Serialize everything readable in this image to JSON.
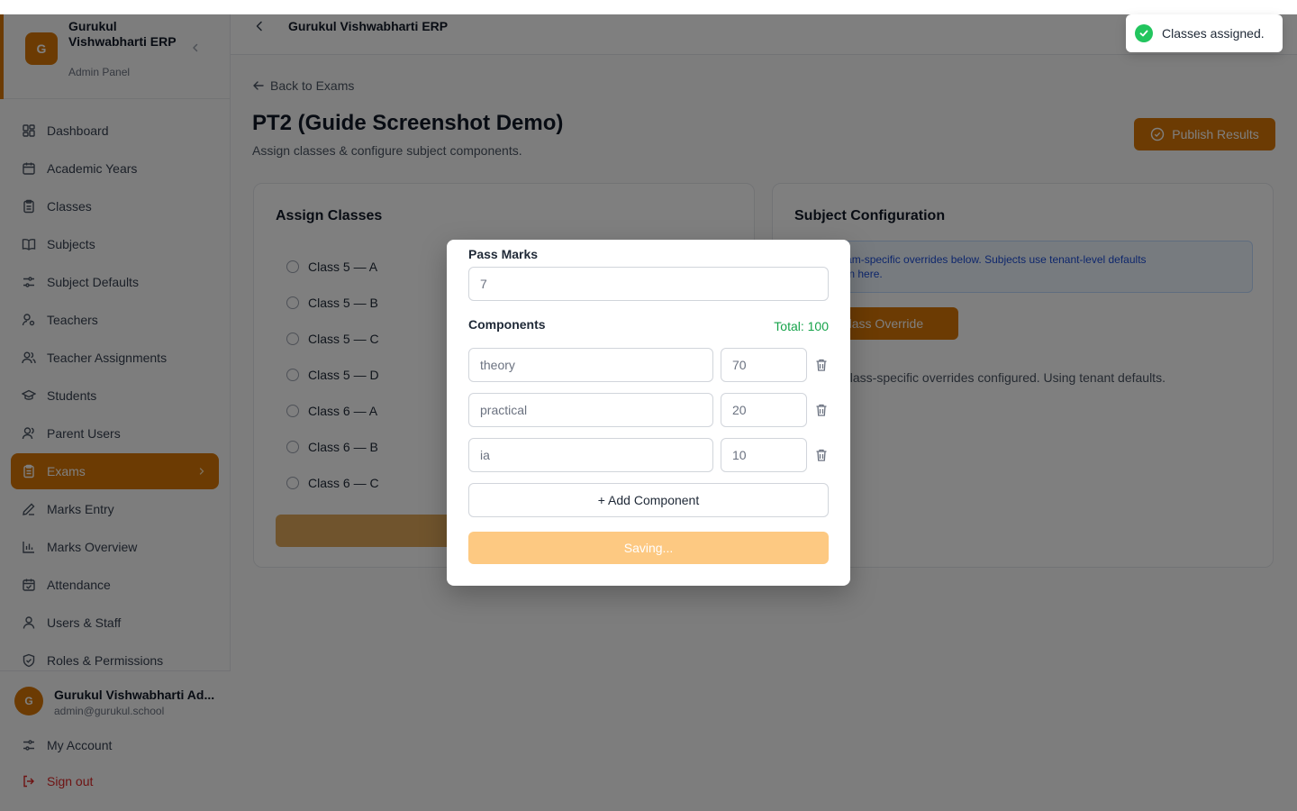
{
  "brand": {
    "logo_letter": "G",
    "name": "Gurukul Vishwabharti ERP",
    "subtitle": "Admin Panel"
  },
  "sidebar": {
    "items": [
      {
        "label": "Dashboard",
        "icon": "dashboard-icon"
      },
      {
        "label": "Academic Years",
        "icon": "calendar-icon"
      },
      {
        "label": "Classes",
        "icon": "clipboard-icon"
      },
      {
        "label": "Subjects",
        "icon": "book-icon"
      },
      {
        "label": "Subject Defaults",
        "icon": "sliders-icon"
      },
      {
        "label": "Teachers",
        "icon": "user-settings-icon"
      },
      {
        "label": "Teacher Assignments",
        "icon": "users-icon"
      },
      {
        "label": "Students",
        "icon": "graduation-cap-icon"
      },
      {
        "label": "Parent Users",
        "icon": "parent-icon"
      },
      {
        "label": "Exams",
        "icon": "clipboard-list-icon",
        "active": true
      },
      {
        "label": "Marks Entry",
        "icon": "pen-icon"
      },
      {
        "label": "Marks Overview",
        "icon": "bar-chart-icon"
      },
      {
        "label": "Attendance",
        "icon": "calendar-check-icon"
      },
      {
        "label": "Users & Staff",
        "icon": "user-icon"
      },
      {
        "label": "Roles & Permissions",
        "icon": "shield-icon"
      }
    ]
  },
  "user": {
    "avatar_letter": "G",
    "name": "Gurukul Vishwabharti Ad...",
    "email": "admin@gurukul.school"
  },
  "footer": {
    "account": "My Account",
    "signout": "Sign out"
  },
  "topbar": {
    "title": "Gurukul Vishwabharti ERP"
  },
  "page": {
    "back": "Back to Exams",
    "title": "PT2 (Guide Screenshot Demo)",
    "subtitle": "Assign classes & configure subject components.",
    "publish": "Publish Results"
  },
  "assign": {
    "title": "Assign Classes",
    "classes": [
      "Class 5 — A",
      "Class 5 — B",
      "Class 5 — C",
      "Class 5 — D",
      "Class 6 — A",
      "Class 6 — B",
      "Class 6 — C"
    ]
  },
  "subject_config": {
    "title": "Subject Configuration",
    "info_line1": "gure exam-specific overrides below. Subjects use tenant-level defaults",
    "info_line2": "verridden here.",
    "override_btn": "d Class Override",
    "no_override": "lo class-specific overrides configured. Using tenant defaults."
  },
  "modal": {
    "pass_marks_label": "Pass Marks",
    "pass_marks_value": "7",
    "components_label": "Components",
    "total": "Total: 100",
    "components": [
      {
        "name": "theory",
        "marks": "70"
      },
      {
        "name": "practical",
        "marks": "20"
      },
      {
        "name": "ia",
        "marks": "10"
      }
    ],
    "add_component": "+ Add Component",
    "saving": "Saving..."
  },
  "toast": {
    "message": "Classes assigned."
  },
  "colors": {
    "accent": "#d97706",
    "success": "#22c55e",
    "danger": "#dc2626"
  }
}
